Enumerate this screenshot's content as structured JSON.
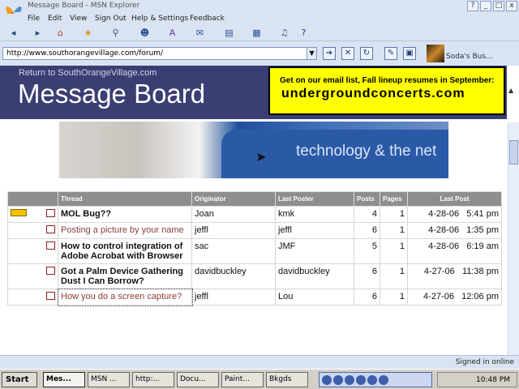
{
  "window": {
    "title": "Message Board - MSN Explorer",
    "controls": [
      "?",
      "_",
      "□",
      "x"
    ]
  },
  "menu": [
    "File",
    "Edit",
    "View",
    "Sign Out",
    "Help & Settings",
    "Feedback"
  ],
  "address": {
    "url": "http://www.southorangevillage.com/forum/",
    "user_name": "Soda's Bus..."
  },
  "banner": {
    "return_link": "Return to SouthOrangeVillage.com",
    "title": "Message Board",
    "ad_line1": "Get on our email list, Fall lineup resumes in September:",
    "ad_line2": "undergroundconcerts.com",
    "hero_text": "technology & the net"
  },
  "table": {
    "headers": [
      "Thread",
      "Originator",
      "Last Poster",
      "Posts",
      "Pages",
      "Last Post"
    ],
    "rows": [
      {
        "new": true,
        "thread": "MOL Bug??",
        "originator": "Joan",
        "last_poster": "kmk",
        "posts": "4",
        "pages": "1",
        "last_post": "4-28-06   5:41 pm",
        "style": "bold"
      },
      {
        "new": false,
        "thread": "Posting a picture by your name",
        "originator": "jeffl",
        "last_poster": "jeffl",
        "posts": "6",
        "pages": "1",
        "last_post": "4-28-06   1:35 pm",
        "style": "visited"
      },
      {
        "new": false,
        "thread": "How to control integration of Adobe Acrobat with Browser",
        "originator": "sac",
        "last_poster": "JMF",
        "posts": "5",
        "pages": "1",
        "last_post": "4-28-06   6:19 am",
        "style": "bold"
      },
      {
        "new": false,
        "thread": "Got a Palm Device Gathering Dust I Can Borrow?",
        "originator": "davidbuckley",
        "last_poster": "davidbuckley",
        "posts": "6",
        "pages": "1",
        "last_post": "4-27-06   11:38 pm",
        "style": "bold"
      },
      {
        "new": false,
        "thread": "How you do a screen capture?",
        "originator": "jeffl",
        "last_poster": "Lou",
        "posts": "6",
        "pages": "1",
        "last_post": "4-27-06   12:06 pm",
        "style": "visited"
      }
    ]
  },
  "status": {
    "text": "Signed in online"
  },
  "taskbar": {
    "start": "Start",
    "tasks": [
      "Mes...",
      "MSN ...",
      "http:...",
      "Docu...",
      "Paint...",
      "Bkgds"
    ],
    "clock": "10:48 PM"
  },
  "colors": {
    "banner_bg": "#3b3e73",
    "ad_bg": "#ffff00",
    "thread_link": "#8b1414",
    "table_header": "#8e8e8e"
  }
}
